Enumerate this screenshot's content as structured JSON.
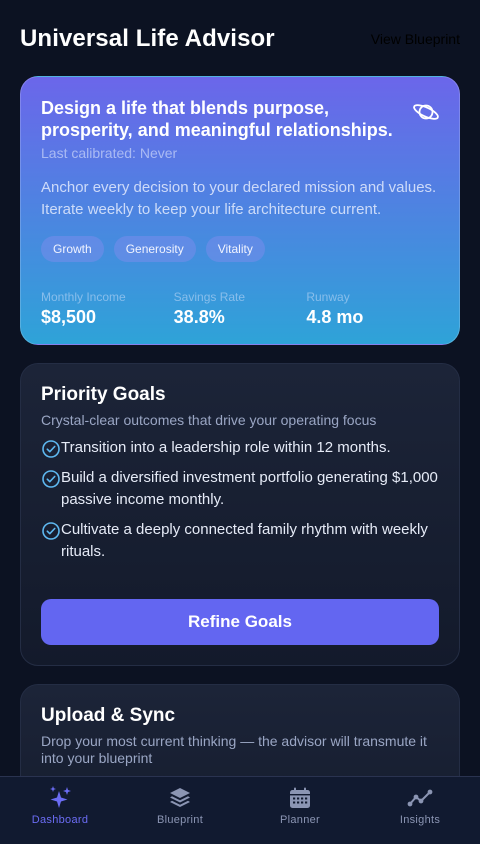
{
  "header": {
    "title": "Universal Life Advisor",
    "view_link": "View Blueprint"
  },
  "hero": {
    "title": "Design a life that blends purpose, prosperity, and meaningful relationships.",
    "calibrated": "Last calibrated: Never",
    "description": "Anchor every decision to your declared mission and values. Iterate weekly to keep your life architecture current.",
    "icon": "planet-icon",
    "tags": [
      "Growth",
      "Generosity",
      "Vitality"
    ],
    "stats": [
      {
        "label": "Monthly Income",
        "value": "$8,500"
      },
      {
        "label": "Savings Rate",
        "value": "38.8%"
      },
      {
        "label": "Runway",
        "value": "4.8 mo"
      }
    ]
  },
  "goals": {
    "title": "Priority Goals",
    "subtitle": "Crystal-clear outcomes that drive your operating focus",
    "items": [
      "Transition into a leadership role within 12 months.",
      "Build a diversified investment portfolio generating $1,000 passive income monthly.",
      "Cultivate a deeply connected family rhythm with weekly rituals."
    ],
    "button": "Refine Goals"
  },
  "upload": {
    "title": "Upload & Sync",
    "subtitle": "Drop your most current thinking — the advisor will transmute it into your blueprint"
  },
  "nav": {
    "items": [
      {
        "label": "Dashboard",
        "icon": "sparkles-icon",
        "active": true
      },
      {
        "label": "Blueprint",
        "icon": "layers-icon",
        "active": false
      },
      {
        "label": "Planner",
        "icon": "calendar-icon",
        "active": false
      },
      {
        "label": "Insights",
        "icon": "trend-line-icon",
        "active": false
      }
    ]
  },
  "colors": {
    "accent": "#6366f1",
    "background": "#0c1222",
    "check": "#5eb8f0"
  }
}
